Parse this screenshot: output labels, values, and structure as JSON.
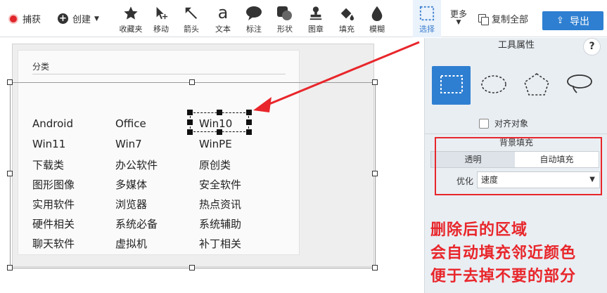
{
  "toolbar": {
    "capture_label": "捕获",
    "create_label": "创建",
    "tools": [
      {
        "label": "收藏夹",
        "icon": "star-icon"
      },
      {
        "label": "移动",
        "icon": "move-icon"
      },
      {
        "label": "箭头",
        "icon": "arrow-icon"
      },
      {
        "label": "文本",
        "icon": "text-icon",
        "glyph": "a"
      },
      {
        "label": "标注",
        "icon": "callout-icon"
      },
      {
        "label": "形状",
        "icon": "shape-icon"
      },
      {
        "label": "图章",
        "icon": "stamp-icon"
      },
      {
        "label": "填充",
        "icon": "fill-icon"
      },
      {
        "label": "模糊",
        "icon": "blur-icon"
      },
      {
        "label": "选择",
        "icon": "select-icon"
      }
    ],
    "more_label": "更多",
    "copy_all_label": "复制全部",
    "export_label": "导出",
    "accent_color": "#2e7fd1"
  },
  "canvas": {
    "card_title": "分类",
    "cells": [
      [
        "Android",
        "Office",
        "Win10"
      ],
      [
        "Win11",
        "Win7",
        "WinPE"
      ],
      [
        "下载类",
        "办公软件",
        "原创类"
      ],
      [
        "图形图像",
        "多媒体",
        "安全软件"
      ],
      [
        "实用软件",
        "浏览器",
        "热点资讯"
      ],
      [
        "硬件相关",
        "系统必备",
        "系统辅助"
      ],
      [
        "聊天软件",
        "虚拟机",
        "补丁相关"
      ]
    ]
  },
  "panel": {
    "title": "工具属性",
    "help_label": "?",
    "shapes": [
      "rect-select-icon",
      "ellipse-select-icon",
      "polygon-select-icon",
      "lasso-select-icon"
    ],
    "align_label": "对齐对象",
    "bg_fill_title": "背景填充",
    "seg_transparent": "透明",
    "seg_autofill": "自动填充",
    "optimize_label": "优化",
    "optimize_value": "速度"
  },
  "annotation": {
    "lines": [
      "删除后的区域",
      "会自动填充邻近颜色",
      "便于去掉不要的部分"
    ],
    "color": "#e8262b"
  }
}
